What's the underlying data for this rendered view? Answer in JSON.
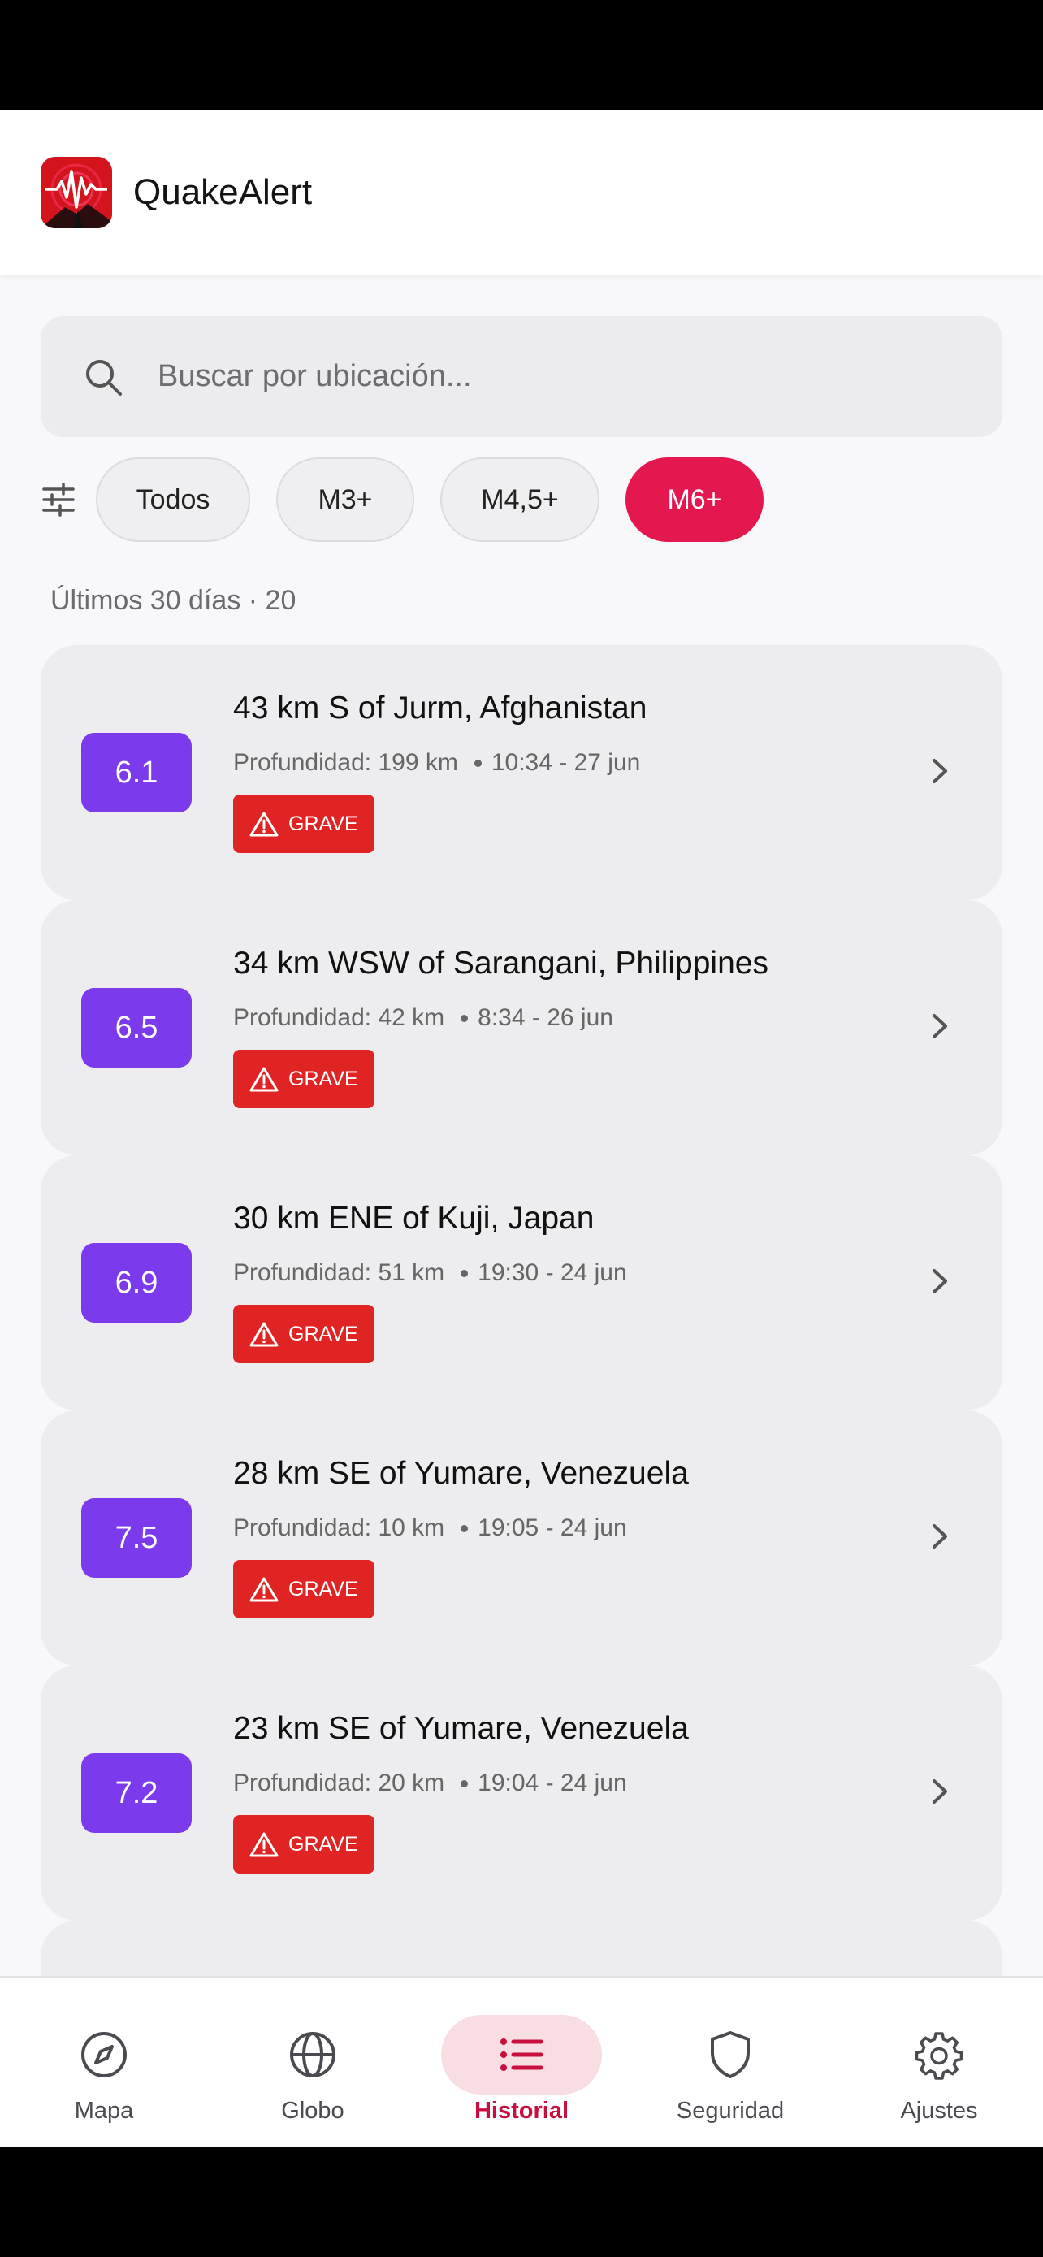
{
  "app": {
    "title": "QuakeAlert"
  },
  "search": {
    "placeholder": "Buscar por ubicación..."
  },
  "filters": {
    "chips": [
      "Todos",
      "M3+",
      "M4,5+",
      "M6+"
    ],
    "selected": "M6+"
  },
  "summary": "Últimos 30 días · 20",
  "quakes": [
    {
      "magnitude": "6.1",
      "place": "43 km S of Jurm, Afghanistan",
      "depth": "Profundidad: 199 km",
      "time": "10:34 - 27 jun",
      "severity": "GRAVE"
    },
    {
      "magnitude": "6.5",
      "place": "34 km WSW of Sarangani, Philippines",
      "depth": "Profundidad: 42 km",
      "time": "8:34 - 26 jun",
      "severity": "GRAVE"
    },
    {
      "magnitude": "6.9",
      "place": "30 km ENE of Kuji, Japan",
      "depth": "Profundidad: 51 km",
      "time": "19:30 - 24 jun",
      "severity": "GRAVE"
    },
    {
      "magnitude": "7.5",
      "place": "28 km SE of Yumare, Venezuela",
      "depth": "Profundidad: 10 km",
      "time": "19:05 - 24 jun",
      "severity": "GRAVE"
    },
    {
      "magnitude": "7.2",
      "place": "23 km SE of Yumare, Venezuela",
      "depth": "Profundidad: 20 km",
      "time": "19:04 - 24 jun",
      "severity": "GRAVE"
    }
  ],
  "nav": {
    "items": [
      {
        "label": "Mapa",
        "icon": "compass-icon"
      },
      {
        "label": "Globo",
        "icon": "globe-icon"
      },
      {
        "label": "Historial",
        "icon": "list-icon"
      },
      {
        "label": "Seguridad",
        "icon": "shield-icon"
      },
      {
        "label": "Ajustes",
        "icon": "gear-icon"
      }
    ],
    "active": "Historial"
  },
  "colors": {
    "accent": "#e4174f",
    "magnitude_badge": "#7c3aed",
    "severity_badge": "#e02424",
    "nav_active": "#c8103e"
  }
}
